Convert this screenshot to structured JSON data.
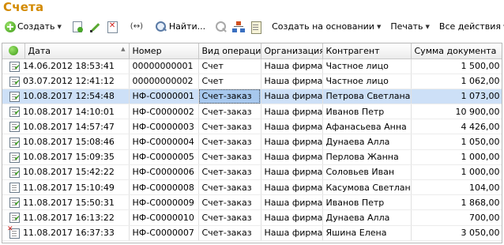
{
  "title": "Счета",
  "toolbar": {
    "create": "Создать",
    "link": "(↔)",
    "find": "Найти...",
    "create_based_on": "Создать на основании",
    "print": "Печать",
    "all_actions": "Все действия",
    "help": "?"
  },
  "columns": [
    "Дата",
    "Номер",
    "Вид операции",
    "Организация",
    "Контрагент",
    "Сумма документа"
  ],
  "rows": [
    {
      "status": "posted",
      "date": "14.06.2012 18:53:41",
      "number": "00000000001",
      "op": "Счет",
      "org": "Наша фирма",
      "contractor": "Частное лицо",
      "sum": "1 500,00"
    },
    {
      "status": "posted",
      "date": "03.07.2012 12:41:12",
      "number": "00000000002",
      "op": "Счет",
      "org": "Наша фирма",
      "contractor": "Частное лицо",
      "sum": "1 062,00"
    },
    {
      "status": "posted",
      "date": "10.08.2017 12:54:48",
      "number": "НФ-С0000001",
      "op": "Счет-заказ",
      "org": "Наша фирма",
      "contractor": "Петрова Светлана",
      "sum": "1 073,00",
      "selected": true
    },
    {
      "status": "posted",
      "date": "10.08.2017 14:10:01",
      "number": "НФ-С0000002",
      "op": "Счет-заказ",
      "org": "Наша фирма",
      "contractor": "Иванов Петр",
      "sum": "10 900,00"
    },
    {
      "status": "posted",
      "date": "10.08.2017 14:57:47",
      "number": "НФ-С0000003",
      "op": "Счет-заказ",
      "org": "Наша фирма",
      "contractor": "Афанасьева Анна",
      "sum": "4 426,00"
    },
    {
      "status": "posted",
      "date": "10.08.2017 15:08:46",
      "number": "НФ-С0000004",
      "op": "Счет-заказ",
      "org": "Наша фирма",
      "contractor": "Дунаева Алла",
      "sum": "1 050,00"
    },
    {
      "status": "posted",
      "date": "10.08.2017 15:09:35",
      "number": "НФ-С0000005",
      "op": "Счет-заказ",
      "org": "Наша фирма",
      "contractor": "Перлова Жанна",
      "sum": "1 000,00"
    },
    {
      "status": "posted",
      "date": "10.08.2017 15:42:22",
      "number": "НФ-С0000006",
      "op": "Счет-заказ",
      "org": "Наша фирма",
      "contractor": "Соловьев Иван",
      "sum": "1 000,00"
    },
    {
      "status": "unposted",
      "date": "11.08.2017 15:10:49",
      "number": "НФ-С0000008",
      "op": "Счет-заказ",
      "org": "Наша фирма",
      "contractor": "Касумова Светлана",
      "sum": "104,00"
    },
    {
      "status": "posted",
      "date": "11.08.2017 15:50:31",
      "number": "НФ-С0000009",
      "op": "Счет-заказ",
      "org": "Наша фирма",
      "contractor": "Иванов Петр",
      "sum": "1 868,00"
    },
    {
      "status": "posted",
      "date": "11.08.2017 16:13:22",
      "number": "НФ-С0000010",
      "op": "Счет-заказ",
      "org": "Наша фирма",
      "contractor": "Дунаева Алла",
      "sum": "700,00"
    },
    {
      "status": "deleted",
      "date": "11.08.2017 16:37:33",
      "number": "НФ-С0000007",
      "op": "Счет-заказ",
      "org": "Наша фирма",
      "contractor": "Яшина Елена",
      "sum": "3 050,00"
    }
  ]
}
